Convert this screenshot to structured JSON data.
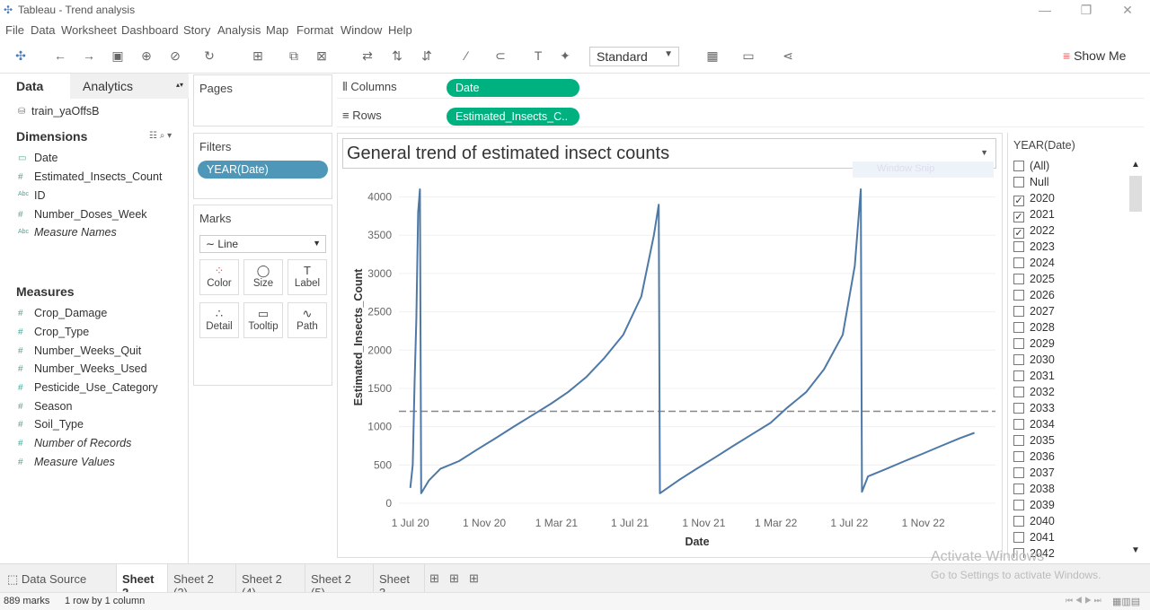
{
  "window": {
    "title": "Tableau - Trend analysis"
  },
  "menu": [
    "File",
    "Data",
    "Worksheet",
    "Dashboard",
    "Story",
    "Analysis",
    "Map",
    "Format",
    "Window",
    "Help"
  ],
  "toolbar": {
    "fit_select": "Standard",
    "show_me": "Show Me"
  },
  "datapane": {
    "tab_data": "Data",
    "tab_analytics": "Analytics",
    "source": "train_yaOffsB",
    "dimensions_header": "Dimensions",
    "dimensions": [
      "Date",
      "Estimated_Insects_Count",
      "ID",
      "Number_Doses_Week",
      "Measure Names"
    ],
    "measures_header": "Measures",
    "measures": [
      "Crop_Damage",
      "Crop_Type",
      "Number_Weeks_Quit",
      "Number_Weeks_Used",
      "Pesticide_Use_Category",
      "Season",
      "Soil_Type",
      "Number of Records",
      "Measure Values"
    ]
  },
  "cards": {
    "pages": "Pages",
    "filters": "Filters",
    "filter_pill": "YEAR(Date)",
    "marks": "Marks",
    "mark_type": "Line",
    "mark_buttons": [
      "Color",
      "Size",
      "Label",
      "Detail",
      "Tooltip",
      "Path"
    ]
  },
  "shelves": {
    "columns_label": "Columns",
    "columns_pill": "Date",
    "rows_label": "Rows",
    "rows_pill": "Estimated_Insects_C.."
  },
  "viz": {
    "title": "General trend of estimated  insect counts",
    "faded_tooltip": "Window Snip"
  },
  "year_filter": {
    "title": "YEAR(Date)",
    "items": [
      {
        "label": "(All)",
        "checked": false
      },
      {
        "label": "Null",
        "checked": false
      },
      {
        "label": "2020",
        "checked": true
      },
      {
        "label": "2021",
        "checked": true
      },
      {
        "label": "2022",
        "checked": true
      },
      {
        "label": "2023",
        "checked": false
      },
      {
        "label": "2024",
        "checked": false
      },
      {
        "label": "2025",
        "checked": false
      },
      {
        "label": "2026",
        "checked": false
      },
      {
        "label": "2027",
        "checked": false
      },
      {
        "label": "2028",
        "checked": false
      },
      {
        "label": "2029",
        "checked": false
      },
      {
        "label": "2030",
        "checked": false
      },
      {
        "label": "2031",
        "checked": false
      },
      {
        "label": "2032",
        "checked": false
      },
      {
        "label": "2033",
        "checked": false
      },
      {
        "label": "2034",
        "checked": false
      },
      {
        "label": "2035",
        "checked": false
      },
      {
        "label": "2036",
        "checked": false
      },
      {
        "label": "2037",
        "checked": false
      },
      {
        "label": "2038",
        "checked": false
      },
      {
        "label": "2039",
        "checked": false
      },
      {
        "label": "2040",
        "checked": false
      },
      {
        "label": "2041",
        "checked": false
      },
      {
        "label": "2042",
        "checked": false
      }
    ]
  },
  "sheet_tabs": [
    "Data Source",
    "Sheet 2",
    "Sheet 2 (2)",
    "Sheet 2 (4)",
    "Sheet 2 (5)",
    "Sheet 3"
  ],
  "active_tab": "Sheet 2",
  "status": {
    "marks": "889 marks",
    "layout": "1 row by 1 column"
  },
  "watermark": {
    "line1": "Activate Windows",
    "line2": "Go to Settings to activate Windows."
  },
  "chart_data": {
    "type": "line",
    "title": "",
    "xlabel": "Date",
    "ylabel": "Estimated_Insects_Count",
    "x_ticks": [
      "1 Jul 20",
      "1 Nov 20",
      "1 Mar 21",
      "1 Jul 21",
      "1 Nov 21",
      "1 Mar 22",
      "1 Jul 22",
      "1 Nov 22"
    ],
    "y_ticks": [
      0,
      500,
      1000,
      1500,
      2000,
      2500,
      3000,
      3500,
      4000
    ],
    "ylim": [
      0,
      4100
    ],
    "color": "#4e79a7",
    "reference_line": {
      "value": 1200,
      "style": "dashed",
      "color": "#888888"
    },
    "series": [
      {
        "points": [
          [
            "2020-07-01",
            200
          ],
          [
            "2020-07-05",
            500
          ],
          [
            "2020-07-08",
            1550
          ],
          [
            "2020-07-11",
            2400
          ],
          [
            "2020-07-14",
            3800
          ],
          [
            "2020-07-17",
            4100
          ],
          [
            "2020-07-19",
            130
          ],
          [
            "2020-08-01",
            300
          ],
          [
            "2020-08-20",
            450
          ],
          [
            "2020-09-20",
            550
          ],
          [
            "2020-10-20",
            700
          ],
          [
            "2020-11-20",
            850
          ],
          [
            "2020-12-20",
            1000
          ],
          [
            "2021-01-20",
            1150
          ],
          [
            "2021-02-20",
            1300
          ],
          [
            "2021-03-20",
            1450
          ],
          [
            "2021-04-20",
            1650
          ],
          [
            "2021-05-20",
            1900
          ],
          [
            "2021-06-20",
            2200
          ],
          [
            "2021-07-20",
            2700
          ],
          [
            "2021-08-10",
            3500
          ],
          [
            "2021-08-18",
            3900
          ],
          [
            "2021-08-20",
            130
          ],
          [
            "2021-09-20",
            300
          ],
          [
            "2021-10-20",
            450
          ],
          [
            "2021-11-20",
            600
          ],
          [
            "2021-12-20",
            750
          ],
          [
            "2022-01-20",
            900
          ],
          [
            "2022-02-20",
            1050
          ],
          [
            "2022-03-20",
            1250
          ],
          [
            "2022-04-20",
            1450
          ],
          [
            "2022-05-20",
            1750
          ],
          [
            "2022-06-20",
            2200
          ],
          [
            "2022-07-10",
            3100
          ],
          [
            "2022-07-20",
            4100
          ],
          [
            "2022-07-22",
            150
          ],
          [
            "2022-08-01",
            350
          ],
          [
            "2022-09-01",
            450
          ],
          [
            "2022-10-01",
            550
          ],
          [
            "2022-11-01",
            650
          ],
          [
            "2022-12-01",
            750
          ],
          [
            "2023-01-01",
            850
          ],
          [
            "2023-01-25",
            920
          ]
        ]
      }
    ]
  }
}
